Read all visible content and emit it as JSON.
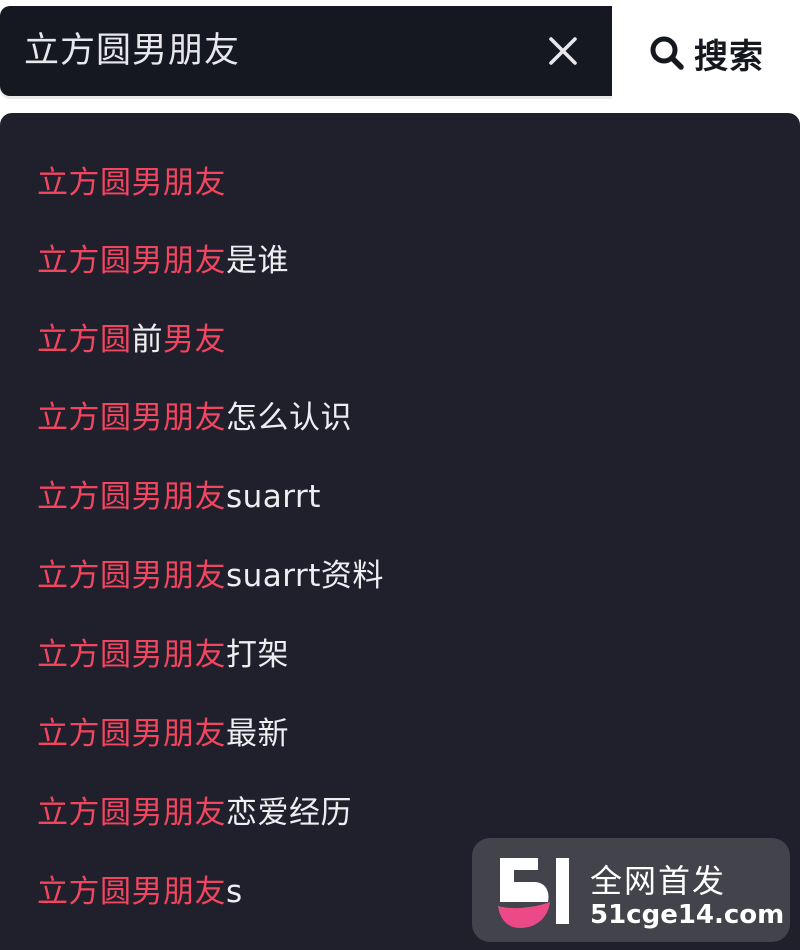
{
  "search": {
    "query": "立方圆男朋友",
    "button_label": "搜索",
    "clear_icon": "close-icon",
    "search_icon": "magnifier-icon"
  },
  "suggestions": [
    {
      "hl1": "立方圆男朋友",
      "rest1": "",
      "hl2": ""
    },
    {
      "hl1": "立方圆男朋友",
      "rest1": "是谁",
      "hl2": ""
    },
    {
      "hl1": "立方圆",
      "rest1": "前",
      "hl2": "男友"
    },
    {
      "hl1": "立方圆男朋友",
      "rest1": "怎么认识",
      "hl2": ""
    },
    {
      "hl1": "立方圆男朋友",
      "rest1": "suarrt",
      "hl2": ""
    },
    {
      "hl1": "立方圆男朋友",
      "rest1": "suarrt资料",
      "hl2": ""
    },
    {
      "hl1": "立方圆男朋友",
      "rest1": "打架",
      "hl2": ""
    },
    {
      "hl1": "立方圆男朋友",
      "rest1": "最新",
      "hl2": ""
    },
    {
      "hl1": "立方圆男朋友",
      "rest1": "恋爱经历",
      "hl2": ""
    },
    {
      "hl1": "立方圆男朋友",
      "rest1": "s",
      "hl2": ""
    }
  ],
  "watermark": {
    "title": "全网首发",
    "url": "51cge14.com",
    "logo_text": "51"
  },
  "colors": {
    "highlight": "#f2455f",
    "dropdown_bg": "#1f202b",
    "input_bg": "#151721"
  }
}
